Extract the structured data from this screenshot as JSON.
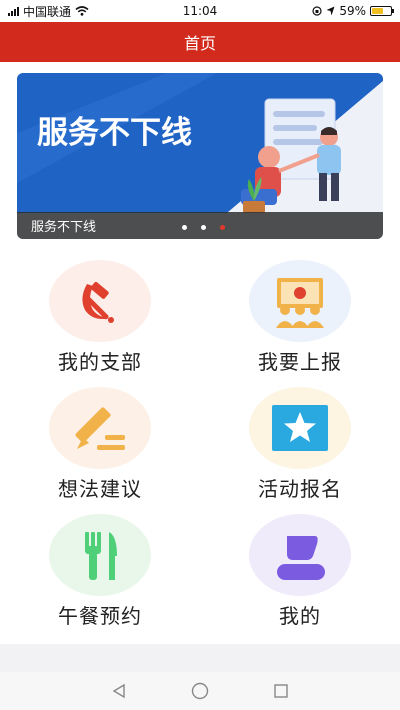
{
  "status_bar": {
    "carrier": "中国联通",
    "time": "11:04",
    "battery": "59%",
    "battery_level": 0.59
  },
  "header": {
    "title": "首页"
  },
  "banner": {
    "headline": "服务不下线",
    "caption": "服务不下线",
    "slide_count": 3,
    "active_slide": 3
  },
  "menu": {
    "items": [
      {
        "label": "我的支部",
        "icon": "hammer-sickle-icon"
      },
      {
        "label": "我要上报",
        "icon": "presentation-group-icon"
      },
      {
        "label": "想法建议",
        "icon": "pencil-icon"
      },
      {
        "label": "活动报名",
        "icon": "star-icon"
      },
      {
        "label": "午餐预约",
        "icon": "fork-knife-icon"
      },
      {
        "label": "我的",
        "icon": "user-icon"
      }
    ]
  },
  "colors": {
    "accent": "#d32a1e",
    "banner_blue": "#1f63c4"
  }
}
